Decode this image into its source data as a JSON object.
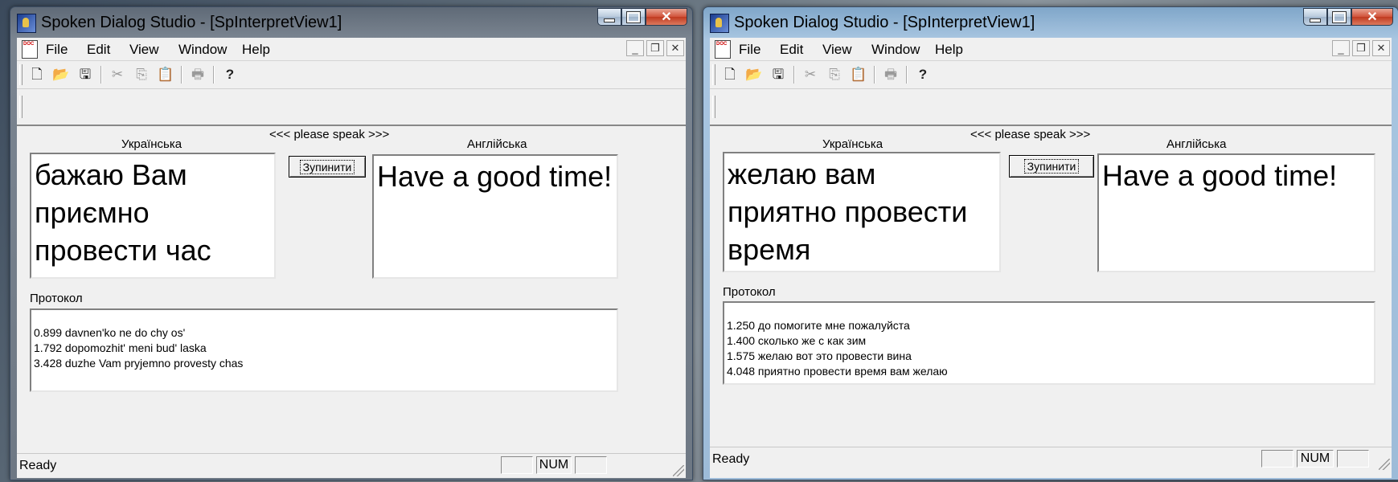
{
  "windows": [
    {
      "title": "Spoken Dialog Studio - [SpInterpretView1]",
      "menu": {
        "file": "File",
        "edit": "Edit",
        "view": "View",
        "window": "Window",
        "help": "Help"
      },
      "prompt": "<<< please speak >>>",
      "source_label": "Українська",
      "target_label": "Англійська",
      "source_text": " бажаю Вам\nприємно\nпровести час",
      "target_text": "Have a good time!",
      "stop_button": "Зупинити",
      "protocol_label": "Протокол",
      "protocol_lines": [
        "0.899 davnen'ko ne do chy os'",
        "1.792 dopomozhit' meni bud' laska",
        "3.428 duzhe Vam pryjemno provesty chas"
      ],
      "status": {
        "text": "Ready",
        "num": "NUM"
      }
    },
    {
      "title": "Spoken Dialog Studio - [SpInterpretView1]",
      "menu": {
        "file": "File",
        "edit": "Edit",
        "view": "View",
        "window": "Window",
        "help": "Help"
      },
      "prompt": "<<< please speak >>>",
      "source_label": "Українська",
      "target_label": "Англійська",
      "source_text": " желаю вам\nприятно провести\nвремя",
      "target_text": "Have a good time!",
      "stop_button": "Зупинити",
      "protocol_label": "Протокол",
      "protocol_lines": [
        "1.250 до помогите мне пожалуйста",
        "1.400 сколько же с как зим",
        "1.575 желаю вот это провести вина",
        "4.048 приятно провести время вам желаю"
      ],
      "status": {
        "text": "Ready",
        "num": "NUM"
      }
    }
  ]
}
